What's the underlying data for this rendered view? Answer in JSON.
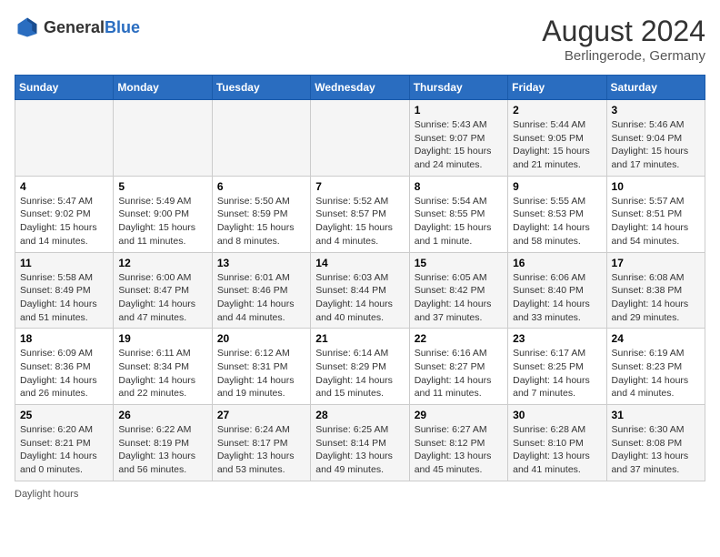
{
  "header": {
    "logo_general": "General",
    "logo_blue": "Blue",
    "month_year": "August 2024",
    "location": "Berlingerode, Germany"
  },
  "days_of_week": [
    "Sunday",
    "Monday",
    "Tuesday",
    "Wednesday",
    "Thursday",
    "Friday",
    "Saturday"
  ],
  "weeks": [
    [
      {
        "day": "",
        "info": ""
      },
      {
        "day": "",
        "info": ""
      },
      {
        "day": "",
        "info": ""
      },
      {
        "day": "",
        "info": ""
      },
      {
        "day": "1",
        "info": "Sunrise: 5:43 AM\nSunset: 9:07 PM\nDaylight: 15 hours and 24 minutes."
      },
      {
        "day": "2",
        "info": "Sunrise: 5:44 AM\nSunset: 9:05 PM\nDaylight: 15 hours and 21 minutes."
      },
      {
        "day": "3",
        "info": "Sunrise: 5:46 AM\nSunset: 9:04 PM\nDaylight: 15 hours and 17 minutes."
      }
    ],
    [
      {
        "day": "4",
        "info": "Sunrise: 5:47 AM\nSunset: 9:02 PM\nDaylight: 15 hours and 14 minutes."
      },
      {
        "day": "5",
        "info": "Sunrise: 5:49 AM\nSunset: 9:00 PM\nDaylight: 15 hours and 11 minutes."
      },
      {
        "day": "6",
        "info": "Sunrise: 5:50 AM\nSunset: 8:59 PM\nDaylight: 15 hours and 8 minutes."
      },
      {
        "day": "7",
        "info": "Sunrise: 5:52 AM\nSunset: 8:57 PM\nDaylight: 15 hours and 4 minutes."
      },
      {
        "day": "8",
        "info": "Sunrise: 5:54 AM\nSunset: 8:55 PM\nDaylight: 15 hours and 1 minute."
      },
      {
        "day": "9",
        "info": "Sunrise: 5:55 AM\nSunset: 8:53 PM\nDaylight: 14 hours and 58 minutes."
      },
      {
        "day": "10",
        "info": "Sunrise: 5:57 AM\nSunset: 8:51 PM\nDaylight: 14 hours and 54 minutes."
      }
    ],
    [
      {
        "day": "11",
        "info": "Sunrise: 5:58 AM\nSunset: 8:49 PM\nDaylight: 14 hours and 51 minutes."
      },
      {
        "day": "12",
        "info": "Sunrise: 6:00 AM\nSunset: 8:47 PM\nDaylight: 14 hours and 47 minutes."
      },
      {
        "day": "13",
        "info": "Sunrise: 6:01 AM\nSunset: 8:46 PM\nDaylight: 14 hours and 44 minutes."
      },
      {
        "day": "14",
        "info": "Sunrise: 6:03 AM\nSunset: 8:44 PM\nDaylight: 14 hours and 40 minutes."
      },
      {
        "day": "15",
        "info": "Sunrise: 6:05 AM\nSunset: 8:42 PM\nDaylight: 14 hours and 37 minutes."
      },
      {
        "day": "16",
        "info": "Sunrise: 6:06 AM\nSunset: 8:40 PM\nDaylight: 14 hours and 33 minutes."
      },
      {
        "day": "17",
        "info": "Sunrise: 6:08 AM\nSunset: 8:38 PM\nDaylight: 14 hours and 29 minutes."
      }
    ],
    [
      {
        "day": "18",
        "info": "Sunrise: 6:09 AM\nSunset: 8:36 PM\nDaylight: 14 hours and 26 minutes."
      },
      {
        "day": "19",
        "info": "Sunrise: 6:11 AM\nSunset: 8:34 PM\nDaylight: 14 hours and 22 minutes."
      },
      {
        "day": "20",
        "info": "Sunrise: 6:12 AM\nSunset: 8:31 PM\nDaylight: 14 hours and 19 minutes."
      },
      {
        "day": "21",
        "info": "Sunrise: 6:14 AM\nSunset: 8:29 PM\nDaylight: 14 hours and 15 minutes."
      },
      {
        "day": "22",
        "info": "Sunrise: 6:16 AM\nSunset: 8:27 PM\nDaylight: 14 hours and 11 minutes."
      },
      {
        "day": "23",
        "info": "Sunrise: 6:17 AM\nSunset: 8:25 PM\nDaylight: 14 hours and 7 minutes."
      },
      {
        "day": "24",
        "info": "Sunrise: 6:19 AM\nSunset: 8:23 PM\nDaylight: 14 hours and 4 minutes."
      }
    ],
    [
      {
        "day": "25",
        "info": "Sunrise: 6:20 AM\nSunset: 8:21 PM\nDaylight: 14 hours and 0 minutes."
      },
      {
        "day": "26",
        "info": "Sunrise: 6:22 AM\nSunset: 8:19 PM\nDaylight: 13 hours and 56 minutes."
      },
      {
        "day": "27",
        "info": "Sunrise: 6:24 AM\nSunset: 8:17 PM\nDaylight: 13 hours and 53 minutes."
      },
      {
        "day": "28",
        "info": "Sunrise: 6:25 AM\nSunset: 8:14 PM\nDaylight: 13 hours and 49 minutes."
      },
      {
        "day": "29",
        "info": "Sunrise: 6:27 AM\nSunset: 8:12 PM\nDaylight: 13 hours and 45 minutes."
      },
      {
        "day": "30",
        "info": "Sunrise: 6:28 AM\nSunset: 8:10 PM\nDaylight: 13 hours and 41 minutes."
      },
      {
        "day": "31",
        "info": "Sunrise: 6:30 AM\nSunset: 8:08 PM\nDaylight: 13 hours and 37 minutes."
      }
    ]
  ],
  "footer": {
    "note": "Daylight hours"
  }
}
